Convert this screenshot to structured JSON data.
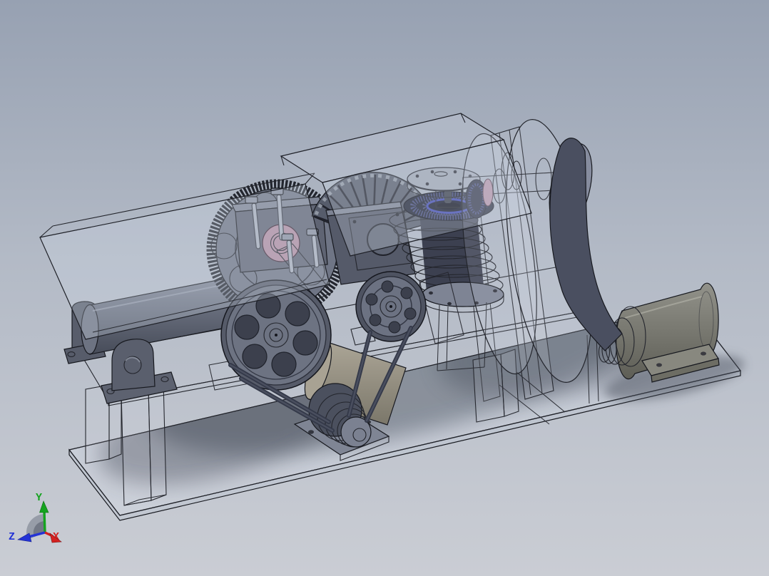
{
  "viewport": {
    "app_context": "3d-cad-viewport",
    "render_style": "shaded-with-transparent-wireframe-edges",
    "subject": "belt-driven machine assembly: motor, flat belt, flywheel discs, finned compressor cylinder, spur gear, pulleys and feed roller on a two-level transparent base"
  },
  "triad": {
    "axes": [
      {
        "label": "Y",
        "color": "#15a31f",
        "direction": "up"
      },
      {
        "label": "Z",
        "color": "#2433d6",
        "direction": "lower-left"
      },
      {
        "label": "X",
        "color": "#d42020",
        "direction": "lower-right"
      }
    ]
  },
  "background": {
    "gradient_top": "#97a1b2",
    "gradient_mid": "#b3bac6",
    "gradient_bottom": "#cacdd4"
  },
  "palette": {
    "part_gray": "#6e7484",
    "part_dark": "#4e5361",
    "edge_color": "#23252c",
    "glass_fill": "rgba(205,214,228,0.30)",
    "accent_blue_ring": "#3f48b0",
    "accent_pink_bushing": "#b28ba0",
    "motor_olive": "#8f8f86",
    "drum_tan": "#a8a293",
    "belt_dark": "#4a4f60"
  },
  "parts": [
    {
      "name": "base-plate"
    },
    {
      "name": "upper-platform"
    },
    {
      "name": "support-legs"
    },
    {
      "name": "left-hopper"
    },
    {
      "name": "right-hopper"
    },
    {
      "name": "feed-roller"
    },
    {
      "name": "bearing-pedestal"
    },
    {
      "name": "spur-gear"
    },
    {
      "name": "gear-bearing-block"
    },
    {
      "name": "mounting-bolts"
    },
    {
      "name": "cooling-fan"
    },
    {
      "name": "crankcase"
    },
    {
      "name": "finned-cylinder"
    },
    {
      "name": "cylinder-head-cap"
    },
    {
      "name": "mounting-flange"
    },
    {
      "name": "large-pulley"
    },
    {
      "name": "small-pulley"
    },
    {
      "name": "step-cone-pulley"
    },
    {
      "name": "idler-drum"
    },
    {
      "name": "v-belts"
    },
    {
      "name": "flywheel-discs"
    },
    {
      "name": "drive-shaft"
    },
    {
      "name": "drive-pulley"
    },
    {
      "name": "drive-belt"
    },
    {
      "name": "electric-motor"
    },
    {
      "name": "motor-base-pad"
    },
    {
      "name": "orientation-triad"
    }
  ]
}
